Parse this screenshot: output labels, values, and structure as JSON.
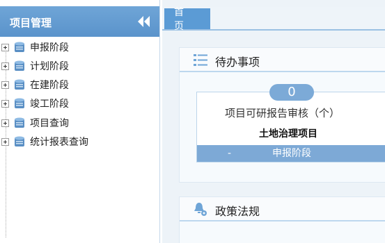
{
  "sidebar": {
    "title": "项目管理",
    "items": [
      {
        "label": "申报阶段"
      },
      {
        "label": "计划阶段"
      },
      {
        "label": "在建阶段"
      },
      {
        "label": "竣工阶段"
      },
      {
        "label": "项目查询"
      },
      {
        "label": "统计报表查询"
      }
    ]
  },
  "tabs": [
    {
      "label": "首页"
    }
  ],
  "panels": {
    "todo": {
      "title": "待办事项",
      "card": {
        "count": "0",
        "title": "项目可研报告审核（个）",
        "subject": "土地治理项目",
        "bullet": "-",
        "stage": "申报阶段"
      }
    },
    "policy": {
      "title": "政策法规"
    }
  },
  "colors": {
    "accent": "#5b9bd5",
    "header": "#6fa5d7",
    "card_footer": "#7da9d6"
  }
}
